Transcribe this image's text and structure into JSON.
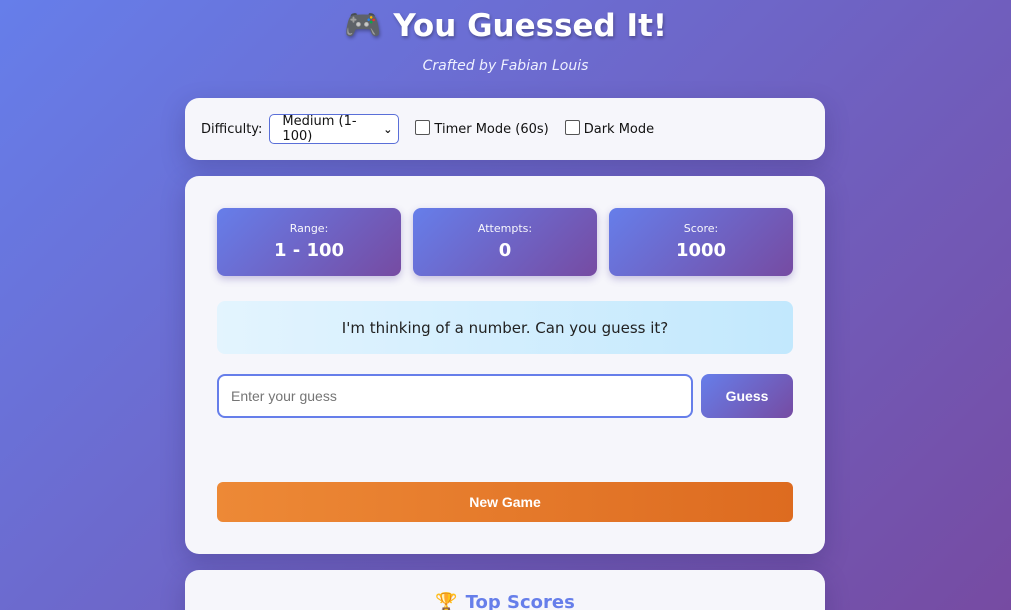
{
  "header": {
    "title": "You Guessed It!",
    "title_icon": "🎮",
    "subtitle": "Crafted by Fabian Louis"
  },
  "settings": {
    "difficulty_label": "Difficulty:",
    "difficulty_selected": "Medium (1-100)",
    "timer_label": "Timer Mode (60s)",
    "timer_checked": false,
    "dark_label": "Dark Mode",
    "dark_checked": false
  },
  "stats": {
    "range_label": "Range:",
    "range_value": "1 - 100",
    "attempts_label": "Attempts:",
    "attempts_value": "0",
    "score_label": "Score:",
    "score_value": "1000"
  },
  "message": "I'm thinking of a number. Can you guess it?",
  "guess": {
    "placeholder": "Enter your guess",
    "value": "",
    "button_label": "Guess"
  },
  "new_game_label": "New Game",
  "top_scores": {
    "title": "Top Scores",
    "icon": "🏆"
  },
  "colors": {
    "gradient_start": "#667eea",
    "gradient_end": "#764ba2",
    "new_game_start": "#ed8936",
    "new_game_end": "#dd6b20"
  }
}
